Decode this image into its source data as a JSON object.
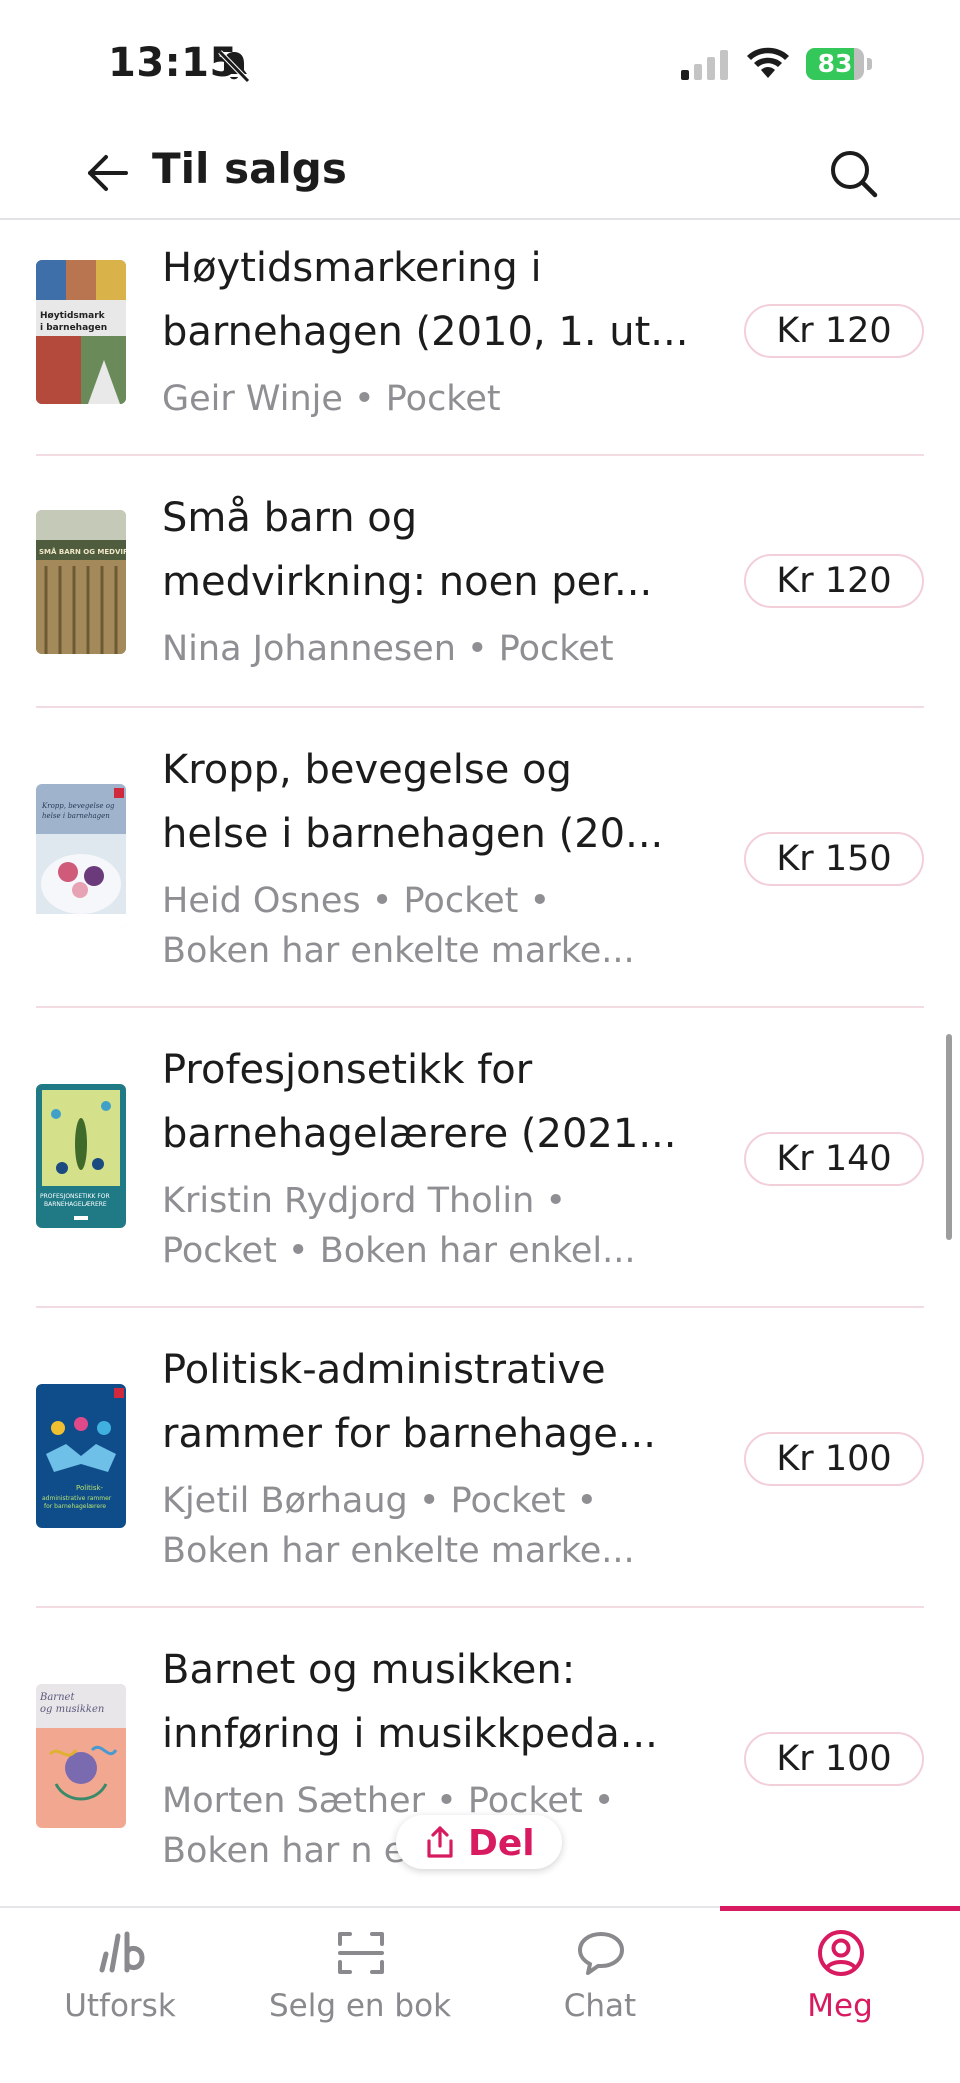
{
  "status_bar": {
    "time": "13:15",
    "battery": "83",
    "battery_level": 0.83
  },
  "header": {
    "title": "Til salgs"
  },
  "books": [
    {
      "title_line1": "Høytidsmarkering i",
      "title_line2": "barnehagen (2010, 1. ut...",
      "meta_line1": "Geir Winje • Pocket",
      "meta_line2": "",
      "price": "Kr 120",
      "cover_text": "Høytidsmark i barnehagen"
    },
    {
      "title_line1": "Små barn og",
      "title_line2": "medvirkning: noen per...",
      "meta_line1": "Nina Johannesen • Pocket",
      "meta_line2": "",
      "price": "Kr 120",
      "cover_text": "SMÅ BARN OG MEDVIRKNING"
    },
    {
      "title_line1": "Kropp, bevegelse og",
      "title_line2": "helse i barnehagen (20...",
      "meta_line1": "Heid Osnes • Pocket •",
      "meta_line2": "Boken har enkelte marke...",
      "price": "Kr 150",
      "cover_text": "Kropp, bevegelse og helse i barnehagen"
    },
    {
      "title_line1": "Profesjonsetikk for",
      "title_line2": "barnehagelærere (2021...",
      "meta_line1": "Kristin Rydjord Tholin •",
      "meta_line2": "Pocket • Boken har enkel...",
      "price": "Kr 140",
      "cover_text": "PROFESJONSETIKK FOR BARNEHAGELÆRERE"
    },
    {
      "title_line1": "Politisk-administrative",
      "title_line2": "rammer for barnehage...",
      "meta_line1": "Kjetil Børhaug • Pocket •",
      "meta_line2": "Boken har enkelte marke...",
      "price": "Kr 100",
      "cover_text": "Politisk-administrative rammer for barnehagelærere"
    },
    {
      "title_line1": "Barnet og musikken:",
      "title_line2": "innføring i musikkpeda...",
      "meta_line1": "Morten Sæther • Pocket •",
      "meta_line2": "Boken har n      ekke...",
      "price": "Kr 100",
      "cover_text": "Barnet og musikken"
    }
  ],
  "share_button": {
    "label": "Del"
  },
  "tabs": [
    {
      "label": "Utforsk",
      "icon": "lb-logo-icon"
    },
    {
      "label": "Selg en bok",
      "icon": "scan-icon"
    },
    {
      "label": "Chat",
      "icon": "chat-bubble-icon"
    },
    {
      "label": "Meg",
      "icon": "profile-icon",
      "active": true
    }
  ],
  "colors": {
    "accent": "#d81b60",
    "text": "#1c1c1c",
    "secondary_text": "#8e8e93",
    "divider": "#f3dbe2"
  }
}
